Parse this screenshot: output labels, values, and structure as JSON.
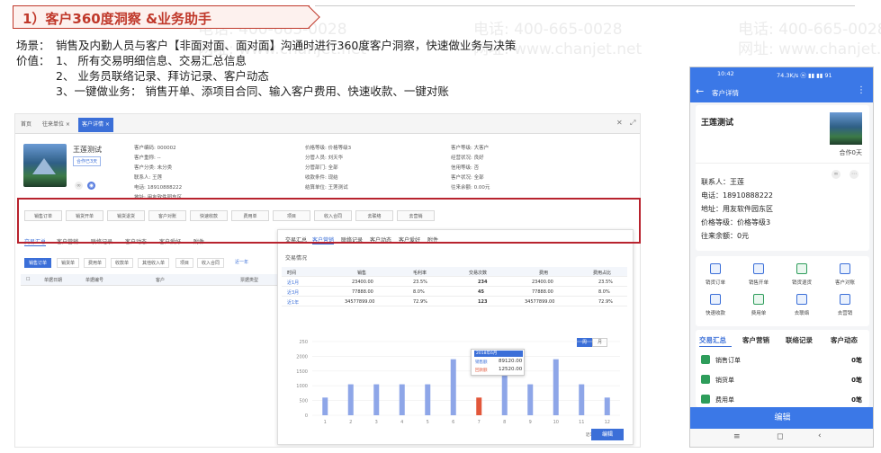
{
  "watermark": {
    "phone": "电话: 400-665-0028",
    "site": "网址: www.chanjet.net"
  },
  "slide": {
    "title": "1）客户360度洞察 &业务助手",
    "scene_label": "场景：",
    "scene_text": "销售及内勤人员与客户【非面对面、面对面】沟通时进行360度客户洞察，快速做业务与决策",
    "value_label": "价值：",
    "value_items": [
      "1、 所有交易明细信息、交易汇总信息",
      "2、 业务员联络记录、拜访记录、客户动态",
      "3、一键做业务： 销售开单、添项目合同、输入客户费用、快速收款、一键对账"
    ]
  },
  "desktop": {
    "tabs": [
      "首页",
      "往来单位 ×",
      "客户详情 ×"
    ],
    "customer_name": "王莲测试",
    "badge": "合作已3天",
    "info": [
      [
        "客户编码: 000002",
        "价格等级: 价格等级3",
        "客户等级: 大客户"
      ],
      [
        "客户重称: --",
        "分管人员: 刘天华",
        "经营状况: 良好"
      ],
      [
        "客户分类: 未分类",
        "分管部门: 全部",
        "信用等级: 否"
      ],
      [
        "联系人: 王莲",
        "收款条件: 现结",
        "客户状况: 全部"
      ],
      [
        "电话: 18910888222",
        "结算单位: 王莲测试",
        "往来余额: 0.00元"
      ],
      [
        "地址: 用友软件园东区",
        "",
        ""
      ]
    ],
    "actions": [
      "销售订单",
      "销货开单",
      "销货退货",
      "客户对账",
      "快速收款",
      "费用单",
      "项目",
      "收入合同",
      "去联络",
      "去营销"
    ],
    "subtabs": [
      "交易汇总",
      "客户营销",
      "联络记录",
      "客户动态",
      "客户爱好",
      "附件"
    ],
    "list_buttons": [
      "销售订单",
      "销货单",
      "费用单",
      "收款单",
      "其他收入单",
      "项目",
      "收入合同",
      "近一年"
    ],
    "table_headers": [
      "单据日期",
      "单据编号",
      "客户",
      "票据类型"
    ],
    "popup": {
      "tabs": [
        "交易汇总",
        "客户营销",
        "联络记录",
        "客户动态",
        "客户爱好",
        "附件"
      ],
      "section": "交易情况",
      "headers": [
        "时间",
        "销售",
        "毛利率",
        "交易次数",
        "费用",
        "费用占比"
      ],
      "rows": [
        [
          "近1月",
          "23400.00",
          "23.5%",
          "234",
          "23400.00",
          "23.5%"
        ],
        [
          "近3月",
          "77888.00",
          "8.0%",
          "45",
          "77888.00",
          "8.0%"
        ],
        [
          "近1年",
          "34577899.00",
          "72.9%",
          "123",
          "34577899.00",
          "72.9%"
        ]
      ],
      "toggle": [
        "周",
        "月"
      ],
      "tooltip": {
        "date": "2018年6月",
        "sales_label": "销售额",
        "sales": "89120.00",
        "receipt_label": "回款额",
        "receipt": "12520.00"
      },
      "chart_note": "近1年客户统计（元）",
      "edit": "编辑"
    }
  },
  "chart_data": {
    "type": "bar",
    "categories": [
      "1",
      "2",
      "3",
      "4",
      "5",
      "6",
      "7",
      "8",
      "9",
      "10",
      "11",
      "12"
    ],
    "yticks": [
      "250",
      "2000",
      "1500",
      "1000",
      "500",
      "0"
    ],
    "ylim": [
      0,
      2500
    ],
    "series": [
      {
        "values": [
          600,
          1050,
          1050,
          1050,
          1050,
          1900,
          600,
          1900,
          1050,
          1900,
          1050,
          600
        ]
      }
    ],
    "highlight_index": 6,
    "bar_color": "#8ea6e8",
    "highlight_color": "#e2573a"
  },
  "mobile": {
    "time": "10:42",
    "status_right": "74.3K/s ⓦ ▮▮ ▮▮ 91",
    "title": "客户详情",
    "name": "王莲测试",
    "coop": "合作0天",
    "lines": [
      "联系人：王莲",
      "电话：18910888222",
      "地址：用友软件园东区",
      "价格等级：价格等级3",
      "往来余额：0元"
    ],
    "icons": [
      "销货订单",
      "销售开单",
      "销货退货",
      "客户对账",
      "快速收款",
      "费用单",
      "去联络",
      "去营销"
    ],
    "tabs": [
      "交易汇总",
      "客户营销",
      "联络记录",
      "客户动态"
    ],
    "rows": [
      {
        "name": "销售订单",
        "value": "0笔"
      },
      {
        "name": "销货单",
        "value": "0笔"
      },
      {
        "name": "费用单",
        "value": "0笔"
      }
    ],
    "edit": "编辑",
    "nav": [
      "≡",
      "◻",
      "‹"
    ]
  }
}
